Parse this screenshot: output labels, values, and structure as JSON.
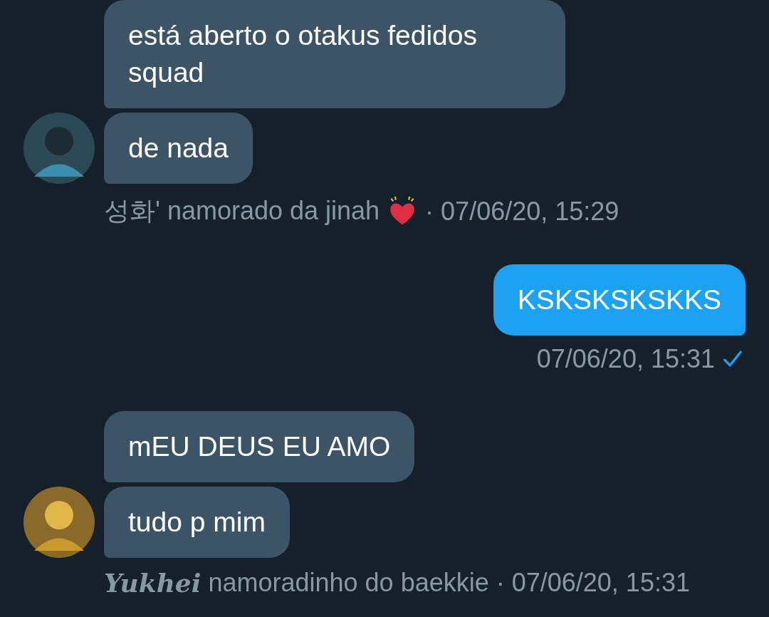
{
  "groups": [
    {
      "kind": "received",
      "messages": [
        "está aberto o otakus fedidos squad",
        "de nada"
      ],
      "sender": {
        "name": "성화' namorado da jinah",
        "heart": true
      },
      "time": "· 07/06/20, 15:29"
    },
    {
      "kind": "sent",
      "messages": [
        "KSKSKSKSKKS"
      ],
      "time": "07/06/20, 15:31",
      "read": true
    },
    {
      "kind": "received",
      "messages": [
        "mEU DEUS EU AMO",
        "tudo p mim"
      ],
      "sender": {
        "styled": "Yukhei",
        "name": "namoradinho do baekkie",
        "heart": false
      },
      "time": "· 07/06/20, 15:31"
    }
  ]
}
